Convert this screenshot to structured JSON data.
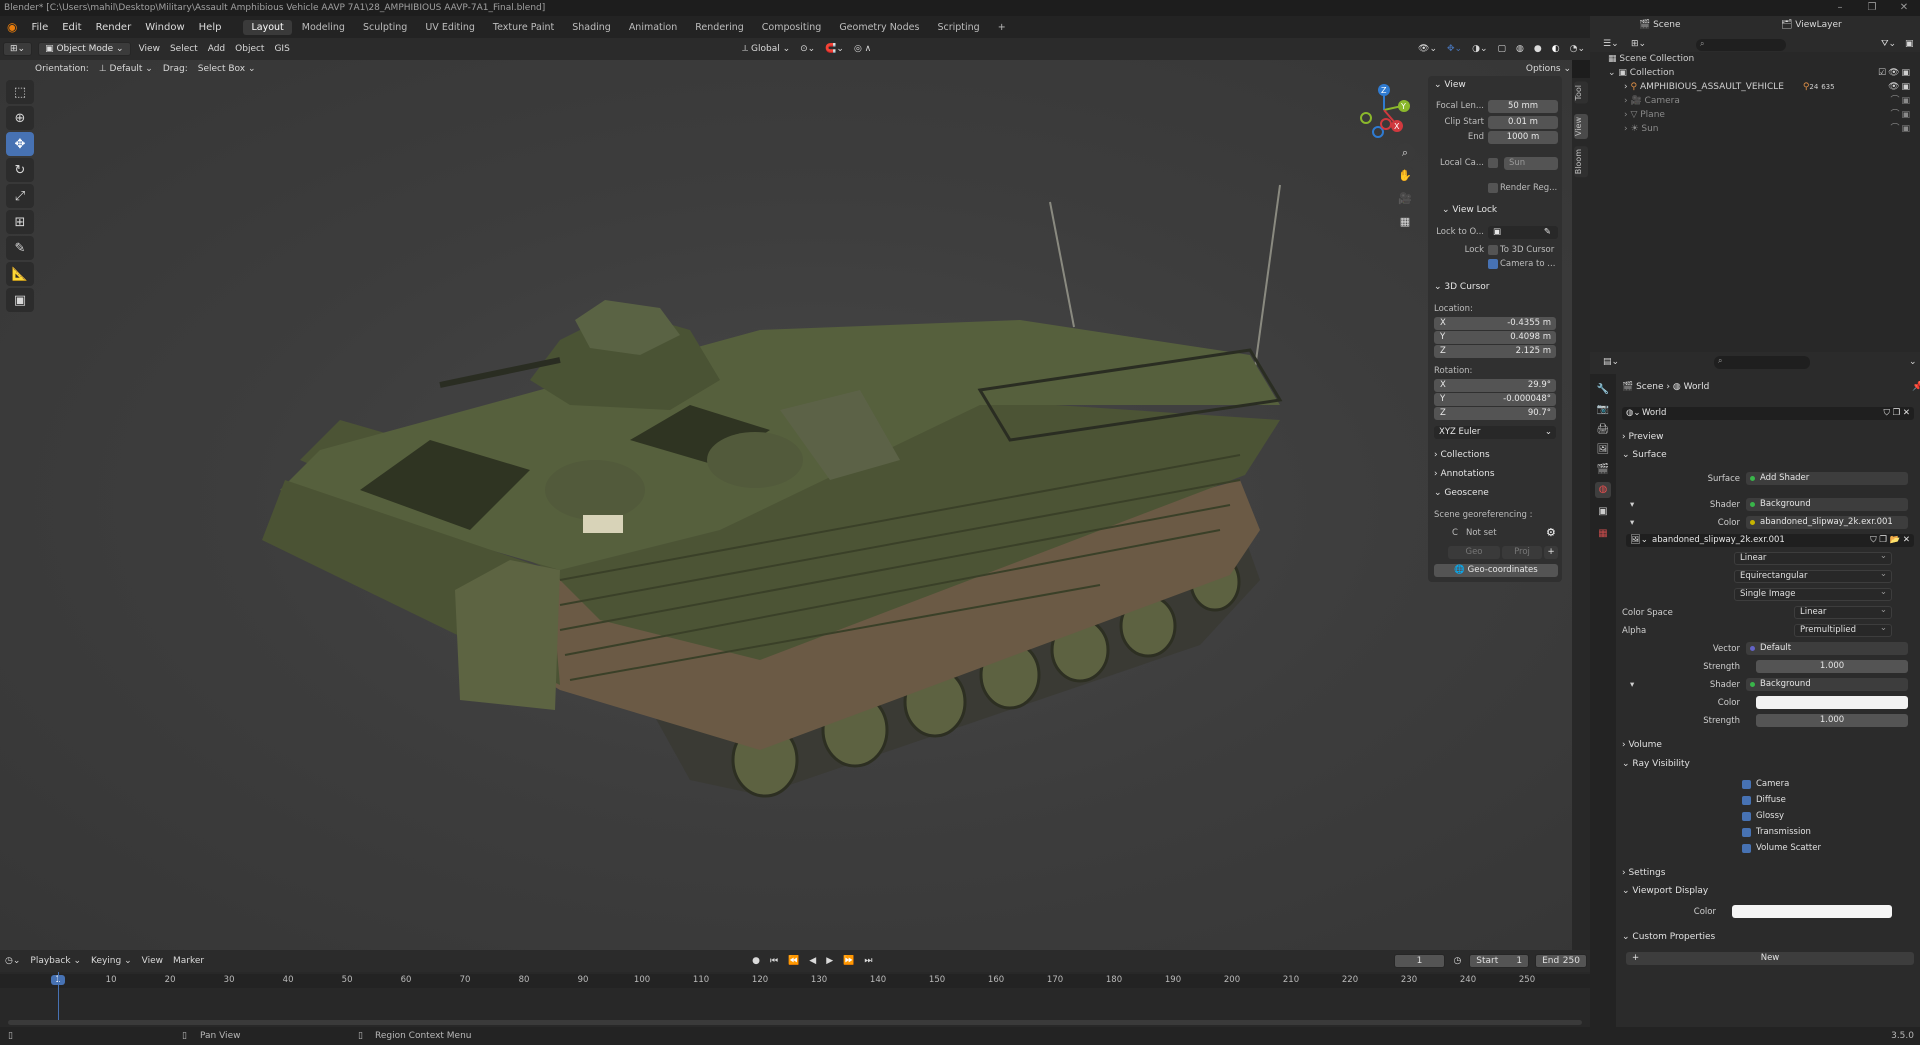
{
  "title_bar": {
    "text": "Blender* [C:\\Users\\mahil\\Desktop\\Military\\Assault Amphibious Vehicle AAVP 7A1\\28_AMPHIBIOUS AAVP-7A1_Final.blend]",
    "controls": [
      "–",
      "❐",
      "✕"
    ]
  },
  "menu": {
    "items": [
      "File",
      "Edit",
      "Render",
      "Window",
      "Help"
    ],
    "workspaces": [
      "Layout",
      "Modeling",
      "Sculpting",
      "UV Editing",
      "Texture Paint",
      "Shading",
      "Animation",
      "Rendering",
      "Compositing",
      "Geometry Nodes",
      "Scripting"
    ],
    "active_workspace": "Layout",
    "add_tab": "+"
  },
  "viewport_header": {
    "mode": "Object Mode",
    "menus": [
      "View",
      "Select",
      "Add",
      "Object",
      "GIS"
    ],
    "transform_orientation": "Global",
    "options": "Options",
    "orientation_label": "Orientation:",
    "orientation_value": "Default",
    "drag_label": "Drag:",
    "drag_value": "Select Box"
  },
  "toolbar": {
    "tools": [
      "select-box-icon",
      "cursor-icon",
      "move-icon",
      "rotate-icon",
      "scale-icon",
      "transform-icon",
      "annotate-icon",
      "measure-icon",
      "add-cube-icon"
    ],
    "active": "move-icon"
  },
  "gizmo": {
    "x": "X",
    "y": "Y",
    "z": "Z"
  },
  "npanel": {
    "tabs": [
      "Tool",
      "View",
      "Bloom"
    ],
    "view": {
      "header": "View",
      "focal_label": "Focal Len...",
      "focal_value": "50 mm",
      "clip_start_label": "Clip Start",
      "clip_start_value": "0.01 m",
      "end_label": "End",
      "end_value": "1000 m",
      "local_camera_label": "Local Ca...",
      "local_camera_value": "Sun",
      "render_region": "Render Reg..."
    },
    "view_lock": {
      "header": "View Lock",
      "lock_obj_label": "Lock to O...",
      "lock_label": "Lock",
      "to_cursor": "To 3D Cursor",
      "camera_to": "Camera to ..."
    },
    "cursor": {
      "header": "3D Cursor",
      "location_label": "Location:",
      "loc": [
        {
          "axis": "X",
          "value": "-0.4355 m"
        },
        {
          "axis": "Y",
          "value": "0.4098 m"
        },
        {
          "axis": "Z",
          "value": "2.125 m"
        }
      ],
      "rotation_label": "Rotation:",
      "rot": [
        {
          "axis": "X",
          "value": "29.9°"
        },
        {
          "axis": "Y",
          "value": "-0.000048°"
        },
        {
          "axis": "Z",
          "value": "90.7°"
        }
      ],
      "rot_mode": "XYZ Euler"
    },
    "collections": "Collections",
    "annotations": "Annotations",
    "geoscene": {
      "header": "Geoscene",
      "georef_label": "Scene georeferencing :",
      "crs": "C",
      "status": "Not set",
      "geo": "Geo",
      "proj": "Proj",
      "geo_coords_button": "Geo-coordinates"
    }
  },
  "timeline": {
    "menus": [
      "Playback",
      "Keying",
      "View",
      "Marker"
    ],
    "current_frame": "1",
    "start_label": "Start",
    "start_value": "1",
    "end_label": "End",
    "end_value": "250",
    "ticks": [
      "1",
      "10",
      "20",
      "30",
      "40",
      "50",
      "60",
      "70",
      "80",
      "90",
      "100",
      "110",
      "120",
      "130",
      "140",
      "150",
      "160",
      "170",
      "180",
      "190",
      "200",
      "210",
      "220",
      "230",
      "240",
      "250"
    ]
  },
  "statusbar": {
    "pan": "Pan View",
    "context": "Region Context Menu",
    "version": "3.5.0"
  },
  "outliner": {
    "scene_label": "Scene",
    "view_layer_label": "ViewLayer",
    "scene_collection": "Scene Collection",
    "collection": "Collection",
    "objects": [
      {
        "name": "AMPHIBIOUS_ASSAULT_VEHICLE",
        "badge": "24",
        "badge2": "635",
        "dim": false
      },
      {
        "name": "Camera",
        "dim": true
      },
      {
        "name": "Plane",
        "dim": true
      },
      {
        "name": "Sun",
        "dim": true
      }
    ]
  },
  "properties": {
    "breadcrumb_scene": "Scene",
    "breadcrumb_world": "World",
    "world_name": "World",
    "preview": "Preview",
    "surface_header": "Surface",
    "surface_label": "Surface",
    "surface_value": "Add Shader",
    "shader_label": "Shader",
    "shader1_value": "Background",
    "color_label": "Color",
    "color1_value": "abandoned_slipway_2k.exr.001",
    "image_name": "abandoned_slipway_2k.exr.001",
    "interp": "Linear",
    "projection": "Equirectangular",
    "source": "Single Image",
    "colorspace_label": "Color Space",
    "colorspace_value": "Linear",
    "alpha_label": "Alpha",
    "alpha_value": "Premultiplied",
    "vector_label": "Vector",
    "vector_value": "Default",
    "strength_label": "Strength",
    "strength1_value": "1.000",
    "shader2_value": "Background",
    "strength2_value": "1.000",
    "volume": "Volume",
    "ray_visibility": "Ray Visibility",
    "rays": [
      "Camera",
      "Diffuse",
      "Glossy",
      "Transmission",
      "Volume Scatter"
    ],
    "settings": "Settings",
    "viewport_display": "Viewport Display",
    "vp_color_label": "Color",
    "custom_props": "Custom Properties",
    "new_button": "New",
    "colors": {
      "accent": "#4772b3",
      "socket_yellow": "#c7b400",
      "socket_blue": "#6363c7"
    }
  }
}
